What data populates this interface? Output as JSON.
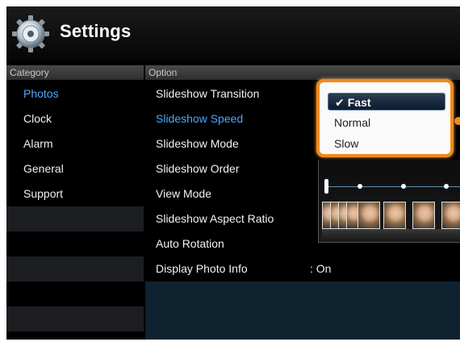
{
  "header": {
    "title": "Settings",
    "icon": "gear-disc-icon"
  },
  "columns": {
    "category": "Category",
    "option": "Option"
  },
  "categories": [
    {
      "label": "Photos",
      "active": true
    },
    {
      "label": "Clock",
      "active": false
    },
    {
      "label": "Alarm",
      "active": false
    },
    {
      "label": "General",
      "active": false
    },
    {
      "label": "Support",
      "active": false
    }
  ],
  "options": [
    {
      "label": "Slideshow Transition",
      "value": ""
    },
    {
      "label": "Slideshow Speed",
      "value": ""
    },
    {
      "label": "Slideshow Mode",
      "value": ""
    },
    {
      "label": "Slideshow Order",
      "value": ""
    },
    {
      "label": "View Mode",
      "value": ""
    },
    {
      "label": "Slideshow Aspect Ratio",
      "value": ""
    },
    {
      "label": "Auto Rotation",
      "value": ""
    },
    {
      "label": "Display Photo Info",
      "value": ": On"
    }
  ],
  "dropdown": {
    "check_icon": "✔",
    "items": [
      {
        "label": "Fast",
        "selected": true
      },
      {
        "label": "Normal",
        "selected": false
      },
      {
        "label": "Slow",
        "selected": false
      }
    ]
  },
  "colors": {
    "accent": "#4aa8ff",
    "highlight": "#f08a1c",
    "background": "#000000",
    "selected_item": "#0d1a2a"
  },
  "preview": {
    "icon": "slideshow-preview",
    "slider_fraction": 0.02
  }
}
